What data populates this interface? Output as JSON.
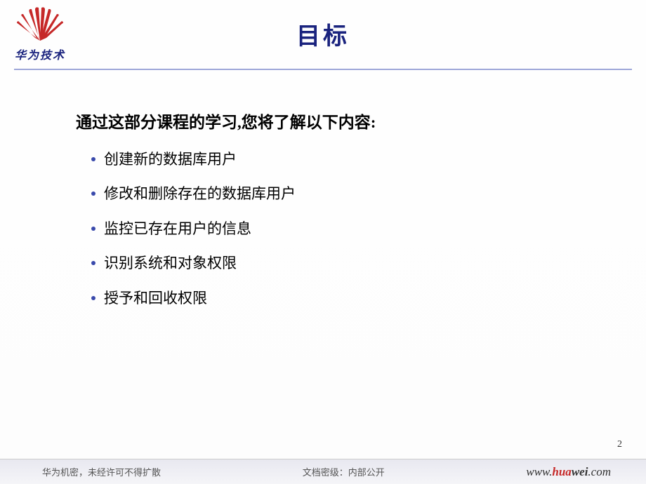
{
  "logo": {
    "text": "华为技术"
  },
  "title": "目标",
  "intro": "通过这部分课程的学习,您将了解以下内容:",
  "bullets": [
    "创建新的数据库用户",
    "修改和删除存在的数据库用户",
    "监控已存在用户的信息",
    "识别系统和对象权限",
    "授予和回收权限"
  ],
  "page_number": "2",
  "footer": {
    "left": "华为机密，未经许可不得扩散",
    "center": "文档密级：内部公开",
    "right_prefix": "www.",
    "right_hua": "hua",
    "right_wei": "wei",
    "right_suffix": ".com"
  }
}
